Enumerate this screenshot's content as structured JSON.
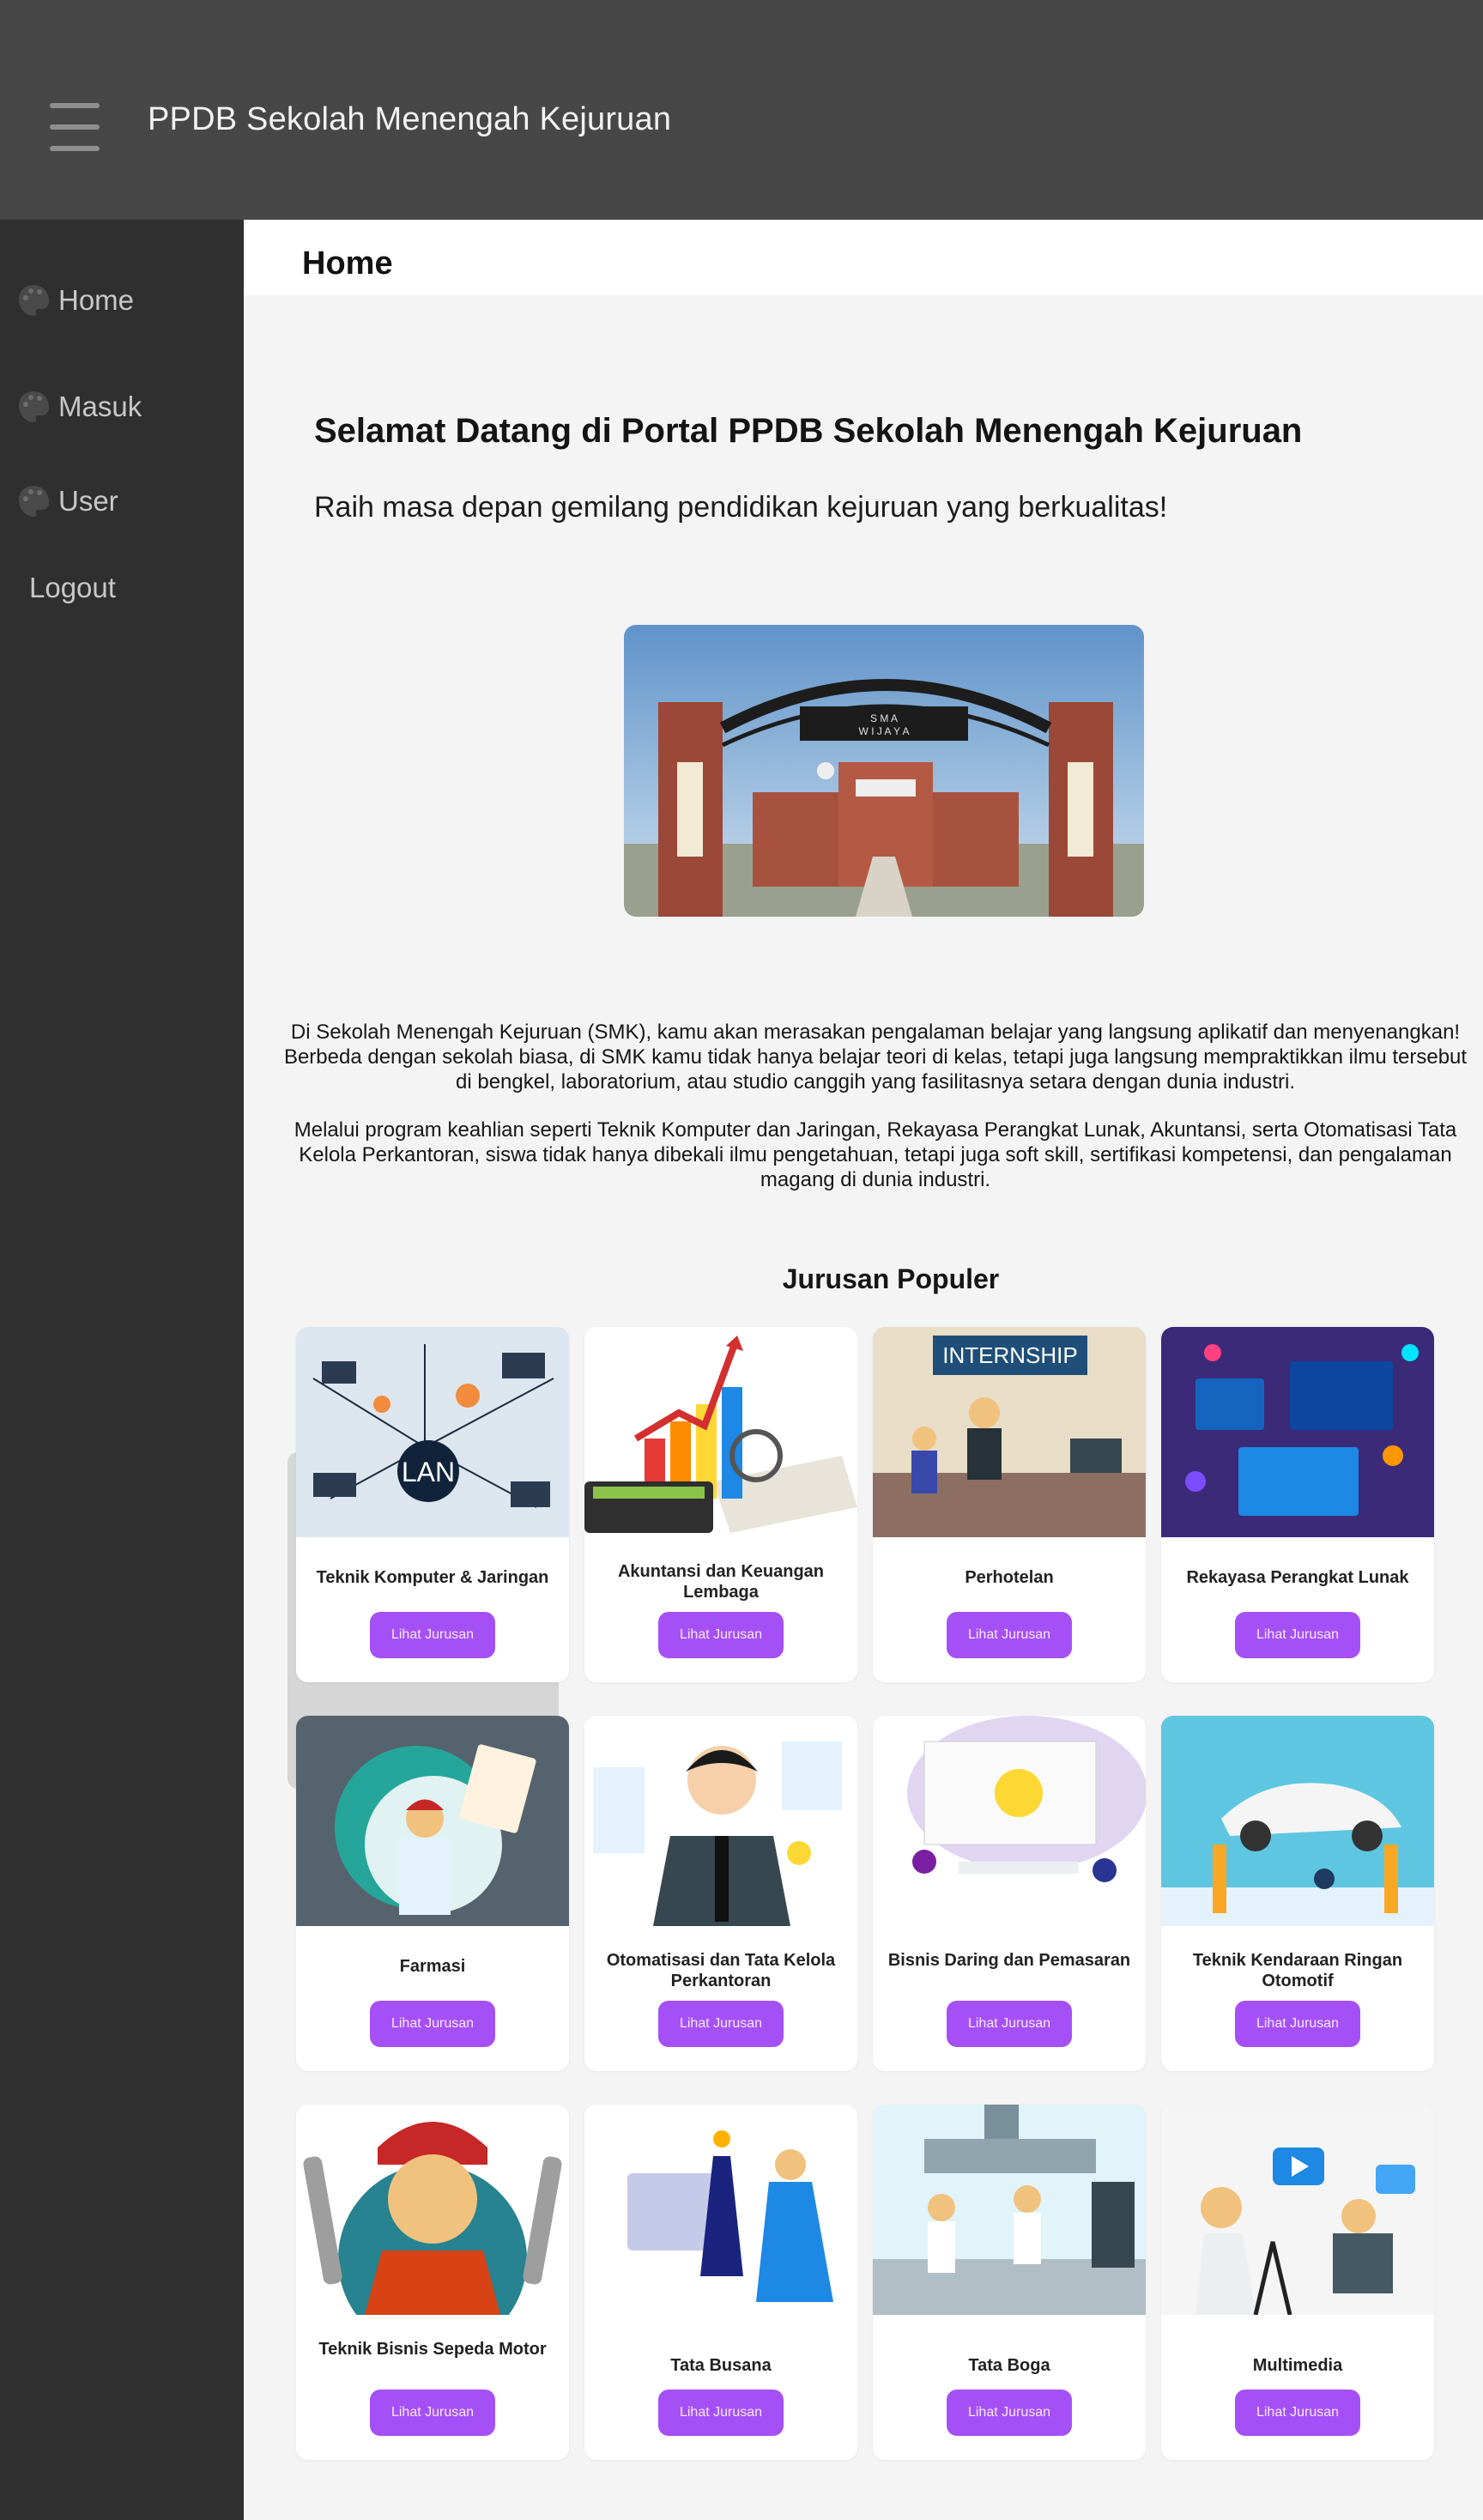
{
  "header": {
    "app_title": "PPDB Sekolah Menengah Kejuruan"
  },
  "sidebar": {
    "items": [
      {
        "label": "Home",
        "icon": "palette-icon"
      },
      {
        "label": "Masuk",
        "icon": "palette-icon"
      },
      {
        "label": "User",
        "icon": "palette-icon"
      },
      {
        "label": "Logout"
      }
    ]
  },
  "page": {
    "title": "Home"
  },
  "hero": {
    "title": "Selamat Datang di Portal PPDB Sekolah Menengah Kejuruan",
    "subtitle": "Raih masa depan gemilang pendidikan kejuruan yang berkualitas!",
    "image_alt": "school-gate-image",
    "gate_sign_line1": "S M A",
    "gate_sign_line2": "W I J A Y A"
  },
  "description": {
    "paragraph1": "Di Sekolah Menengah Kejuruan (SMK), kamu akan merasakan pengalaman belajar yang langsung aplikatif dan menyenangkan! Berbeda dengan sekolah biasa, di SMK kamu tidak hanya belajar teori di kelas, tetapi juga langsung mempraktikkan ilmu tersebut di bengkel, laboratorium, atau studio canggih yang fasilitasnya setara dengan dunia industri.",
    "paragraph2": "Melalui program keahlian seperti Teknik Komputer dan Jaringan, Rekayasa Perangkat Lunak, Akuntansi, serta Otomatisasi Tata Kelola Perkantoran, siswa tidak hanya dibekali ilmu pengetahuan, tetapi juga soft skill, sertifikasi kompetensi, dan pengalaman magang di dunia industri."
  },
  "jurusan": {
    "section_title": "Jurusan Populer",
    "button_label": "Lihat Jurusan",
    "items": [
      {
        "title": "Teknik Komputer & Jaringan",
        "image_text": "LAN"
      },
      {
        "title": "Akuntansi dan Keuangan Lembaga"
      },
      {
        "title": "Perhotelan",
        "image_text": "INTERNSHIP"
      },
      {
        "title": "Rekayasa Perangkat Lunak"
      },
      {
        "title": "Farmasi"
      },
      {
        "title": "Otomatisasi dan Tata Kelola Perkantoran"
      },
      {
        "title": "Bisnis Daring dan Pemasaran"
      },
      {
        "title": "Teknik Kendaraan Ringan Otomotif"
      },
      {
        "title": "Teknik Bisnis Sepeda Motor"
      },
      {
        "title": "Tata Busana"
      },
      {
        "title": "Tata Boga"
      },
      {
        "title": "Multimedia"
      }
    ]
  },
  "colors": {
    "accent": "#a550f7",
    "topbar": "#474747",
    "sidebar": "#2f2f2f"
  }
}
